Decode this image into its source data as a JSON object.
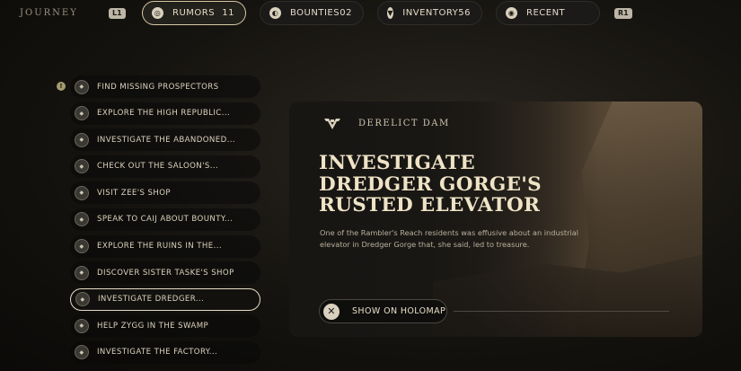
{
  "header": {
    "section_title": "JOURNEY",
    "left_button": "L1",
    "right_button": "R1",
    "tabs": [
      {
        "label": "RUMORS",
        "count": "11",
        "icon": "rumors-icon"
      },
      {
        "label": "BOUNTIES",
        "count": "02",
        "icon": "bounties-icon"
      },
      {
        "label": "INVENTORY",
        "count": "56",
        "icon": "inventory-icon"
      },
      {
        "label": "RECENT",
        "count": "",
        "icon": "recent-icon"
      }
    ]
  },
  "rumors": [
    {
      "label": "FIND MISSING PROSPECTORS"
    },
    {
      "label": "EXPLORE THE HIGH REPUBLIC..."
    },
    {
      "label": "INVESTIGATE THE ABANDONED..."
    },
    {
      "label": "CHECK OUT THE SALOON'S..."
    },
    {
      "label": "VISIT ZEE'S SHOP"
    },
    {
      "label": "SPEAK TO CAIJ ABOUT BOUNTY..."
    },
    {
      "label": "EXPLORE THE RUINS IN THE..."
    },
    {
      "label": "DISCOVER SISTER TASKE'S SHOP"
    },
    {
      "label": "INVESTIGATE DREDGER..."
    },
    {
      "label": "HELP ZYGG IN THE SWAMP"
    },
    {
      "label": "INVESTIGATE THE FACTORY..."
    }
  ],
  "detail": {
    "location": "DERELICT DAM",
    "title": "INVESTIGATE DREDGER GORGE'S RUSTED ELEVATOR",
    "description": "One of the Rambler's Reach residents was effusive about an industrial elevator in Dredger Gorge that, she said, led to treasure.",
    "button_label": "SHOW ON HOLOMAP",
    "button_glyph": "✕"
  },
  "colors": {
    "accent": "#e6dcc5",
    "background": "#15130f"
  }
}
